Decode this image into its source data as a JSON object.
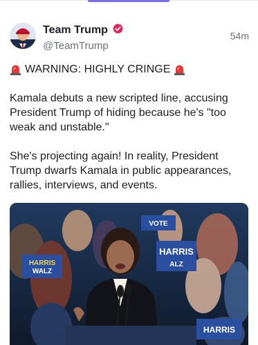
{
  "header": {
    "tab_indicator_color": "#7a6cf0"
  },
  "post": {
    "author": {
      "display_name": "Team Trump",
      "handle": "@TeamTrump",
      "verified_icon": "verified-badge-icon",
      "verified_color": "#e0245e"
    },
    "timestamp": "54m",
    "warning": "WARNING: HIGHLY CRINGE",
    "warning_icon": "siren-icon",
    "paragraphs": [
      "Kamala debuts a new scripted line, accusing President Trump of hiding because he's \"too weak and unstable.\"",
      "She's projecting again! In reality, President Trump dwarfs Kamala in public appearances, rallies, interviews, and events."
    ],
    "media": {
      "signs": [
        "HARRIS",
        "WALZ",
        "VOTE",
        "HARRIS",
        "ALZ",
        "HARRIS"
      ]
    }
  }
}
